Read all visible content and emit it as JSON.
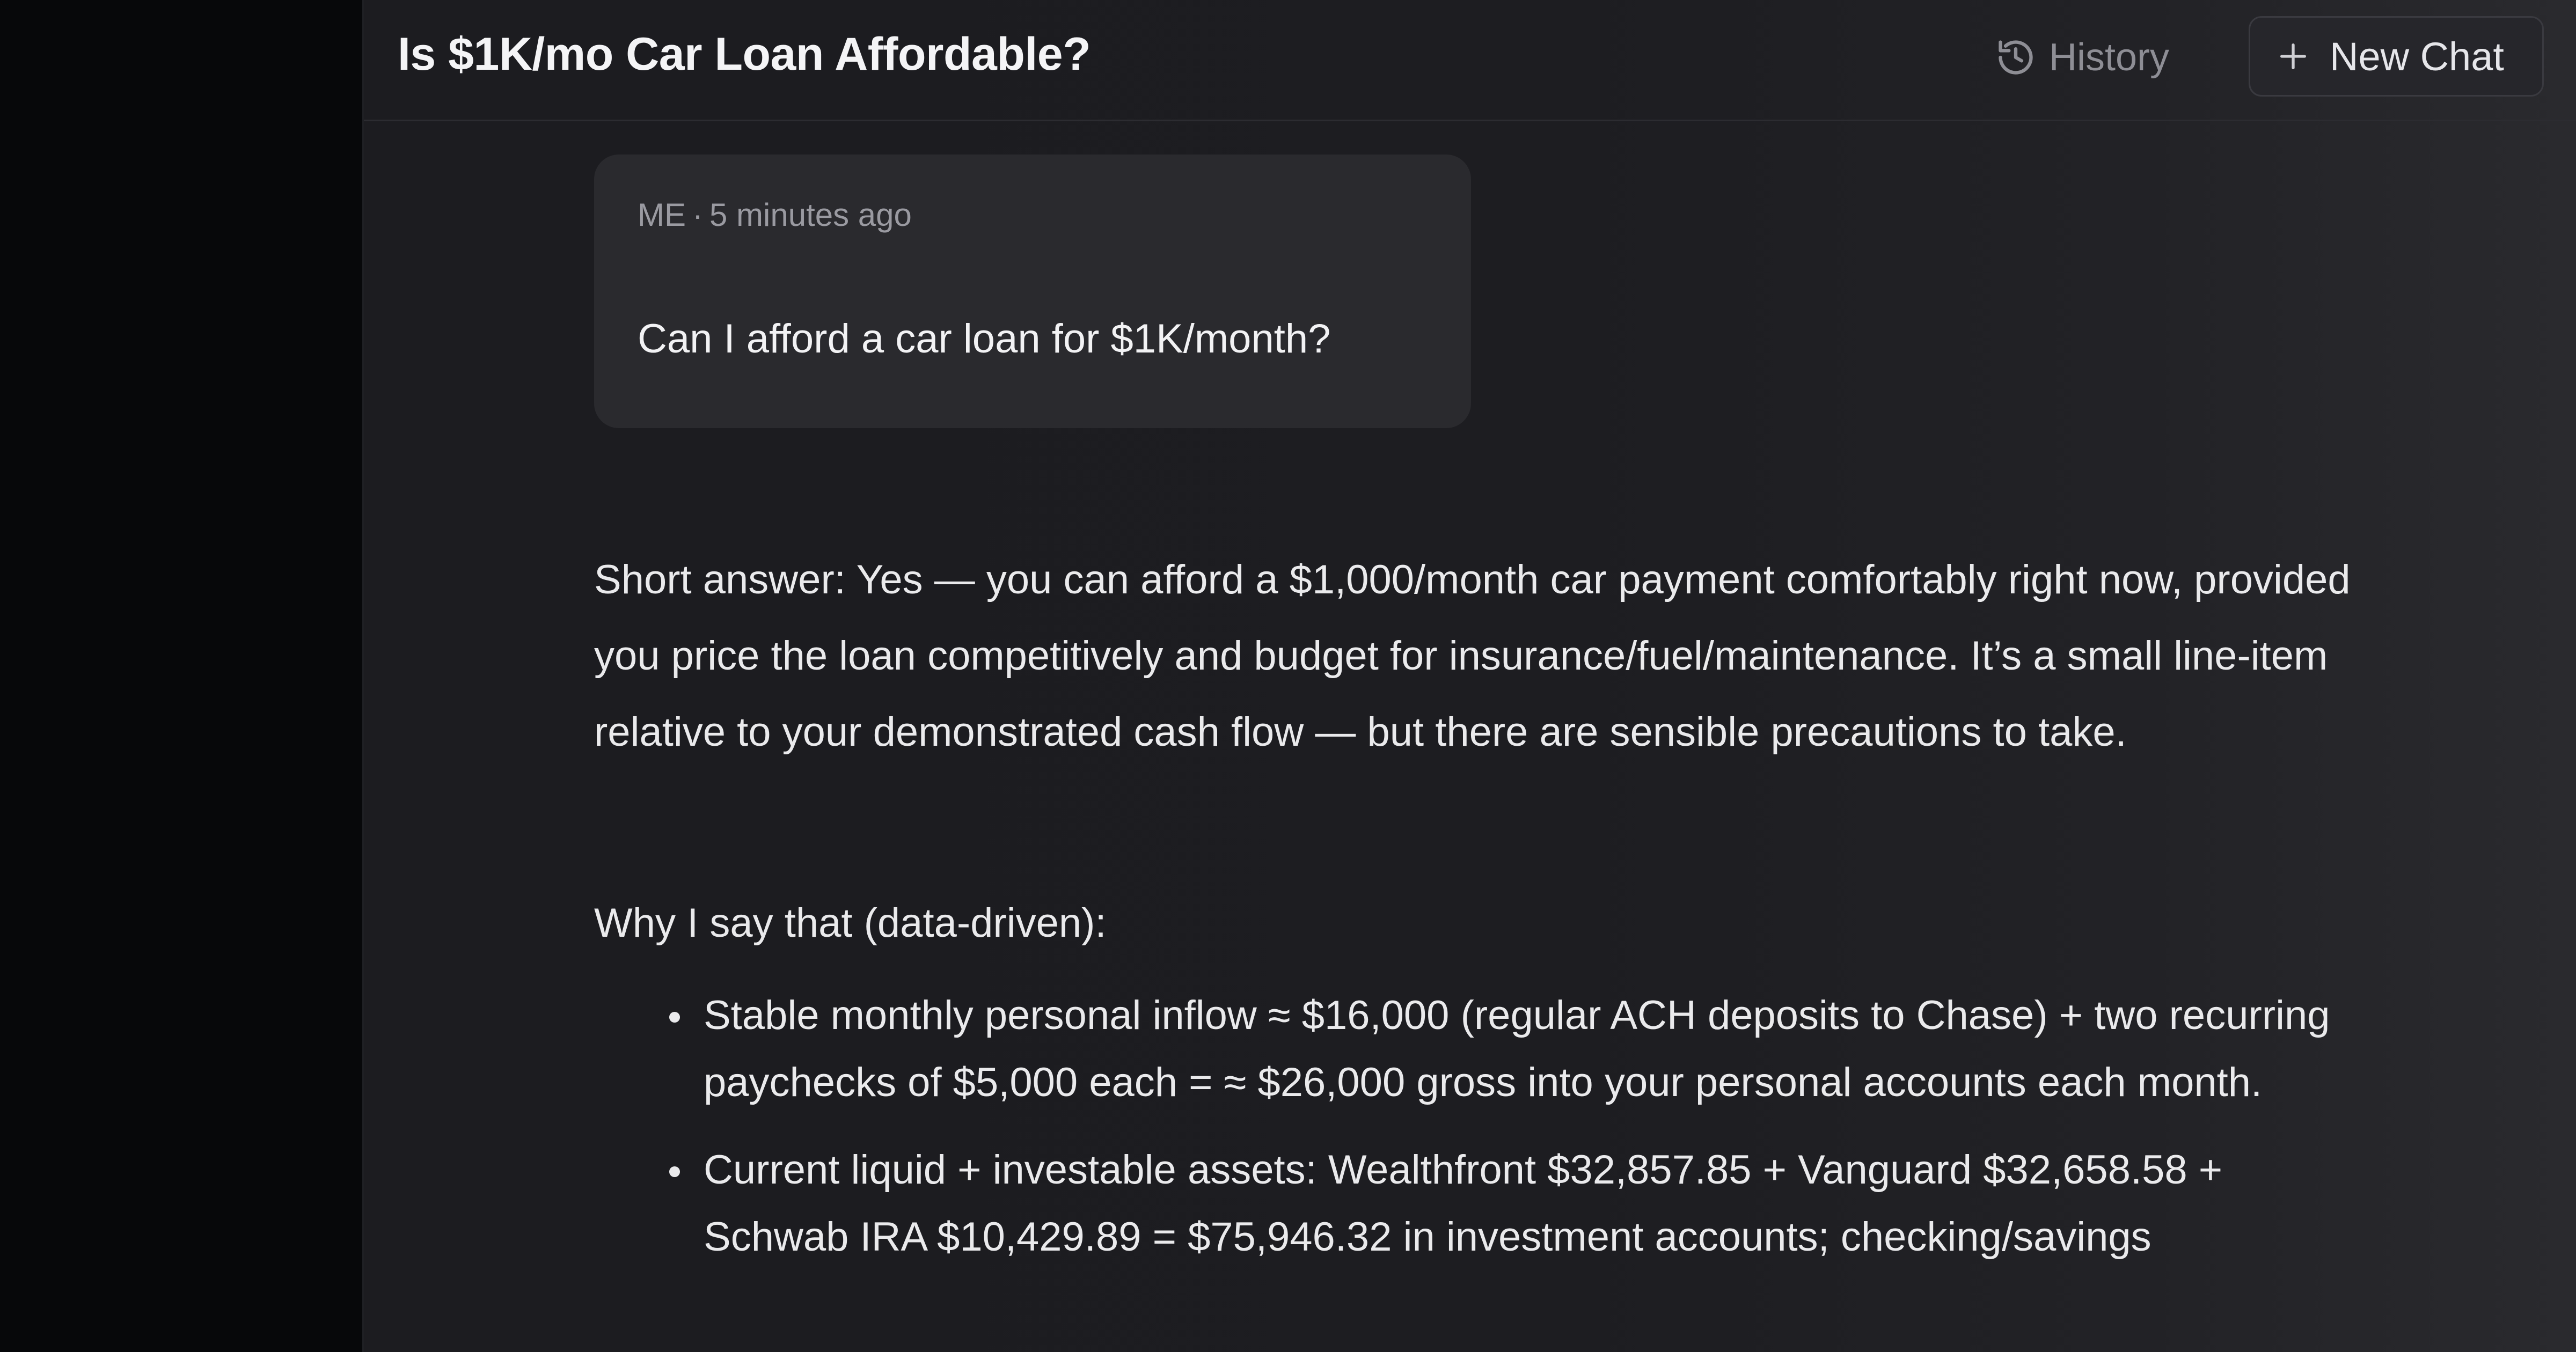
{
  "header": {
    "title": "Is $1K/mo Car Loan Affordable?",
    "history_label": "History",
    "new_chat_label": "New Chat"
  },
  "user_message": {
    "author": "ME",
    "separator": "·",
    "timestamp": "5 minutes ago",
    "text": "Can I afford a car loan for $1K/month?"
  },
  "assistant_message": {
    "intro": "Short answer: Yes — you can afford a $1,000/month car payment comfortably right now, provided you price the loan competitively and budget for insurance/fuel/maintenance. It’s a small line-item relative to your demonstrated cash flow — but there are sensible precautions to take.",
    "section_heading": "Why I say that (data-driven):",
    "bullets": [
      "Stable monthly personal inflow ≈ $16,000 (regular ACH deposits to Chase) + two recurring paychecks of $5,000 each = ≈ $26,000 gross into your personal accounts each month.",
      "Current liquid + investable assets: Wealthfront $32,857.85 + Vanguard $32,658.58 + Schwab IRA $10,429.89 = $75,946.32 in investment accounts; checking/savings"
    ]
  }
}
